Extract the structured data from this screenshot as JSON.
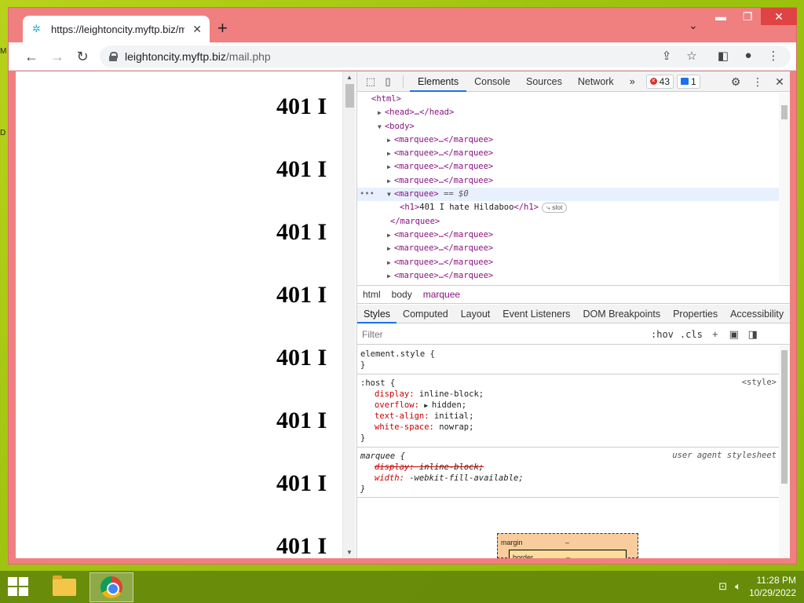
{
  "desktop": {
    "edge_glyph_1": "M",
    "edge_glyph_2": "D"
  },
  "browser": {
    "tab_title": "https://leightoncity.myftp.biz/ma",
    "url_domain": "leightoncity.myftp.biz",
    "url_path": "/mail.php"
  },
  "page": {
    "heading_text": "401 I",
    "heading_count": 8
  },
  "devtools": {
    "tabs": [
      "Elements",
      "Console",
      "Sources",
      "Network"
    ],
    "active_tab": "Elements",
    "more_tabs": "»",
    "error_count": "43",
    "message_count": "1",
    "dom": [
      {
        "indent": 0,
        "tri": "",
        "html": "<html>"
      },
      {
        "indent": 1,
        "tri": "▶",
        "html": "<head>…</head>"
      },
      {
        "indent": 1,
        "tri": "▼",
        "html": "<body>"
      },
      {
        "indent": 2,
        "tri": "▶",
        "html": "<marquee>…</marquee>"
      },
      {
        "indent": 2,
        "tri": "▶",
        "html": "<marquee>…</marquee>"
      },
      {
        "indent": 2,
        "tri": "▶",
        "html": "<marquee>…</marquee>"
      },
      {
        "indent": 2,
        "tri": "▶",
        "html": "<marquee>…</marquee>"
      },
      {
        "indent": 2,
        "tri": "▼",
        "html": "<marquee>",
        "eq": " == $0",
        "selected": true
      },
      {
        "indent": 3,
        "tri": "",
        "html": "<h1>",
        "text": "401 I hate Hildaboo",
        "close": "</h1>",
        "slot": "slot"
      },
      {
        "indent": 2,
        "tri": "",
        "html": "</marquee>"
      },
      {
        "indent": 2,
        "tri": "▶",
        "html": "<marquee>…</marquee>"
      },
      {
        "indent": 2,
        "tri": "▶",
        "html": "<marquee>…</marquee>"
      },
      {
        "indent": 2,
        "tri": "▶",
        "html": "<marquee>…</marquee>"
      },
      {
        "indent": 2,
        "tri": "▶",
        "html": "<marquee>…</marquee>"
      }
    ],
    "breadcrumbs": [
      "html",
      "body",
      "marquee"
    ],
    "style_tabs": [
      "Styles",
      "Computed",
      "Layout",
      "Event Listeners",
      "DOM Breakpoints",
      "Properties",
      "Accessibility"
    ],
    "filter_placeholder": "Filter",
    "hov_label": ":hov",
    "cls_label": ".cls",
    "rules": {
      "element_style": {
        "selector": "element.style {",
        "close": "}"
      },
      "host": {
        "selector": ":host {",
        "source": "<style>",
        "props": [
          {
            "name": "display",
            "value": "inline-block;"
          },
          {
            "name": "overflow",
            "value": "hidden;"
          },
          {
            "name": "text-align",
            "value": "initial;"
          },
          {
            "name": "white-space",
            "value": "nowrap;"
          }
        ],
        "close": "}"
      },
      "marquee": {
        "selector": "marquee {",
        "source": "user agent stylesheet",
        "props": [
          {
            "name": "display",
            "value": "inline-block;"
          },
          {
            "name": "width",
            "value": "-webkit-fill-available;"
          }
        ],
        "close": "}"
      }
    },
    "box_model": {
      "margin_label": "margin",
      "margin_value": "–",
      "border_label": "border",
      "border_value": "–"
    }
  },
  "taskbar": {
    "time": "11:28 PM",
    "date": "10/29/2022"
  },
  "colors": {
    "window_frame": "#f08080",
    "accent": "#1a73e8",
    "taskbar": "#60820a"
  }
}
